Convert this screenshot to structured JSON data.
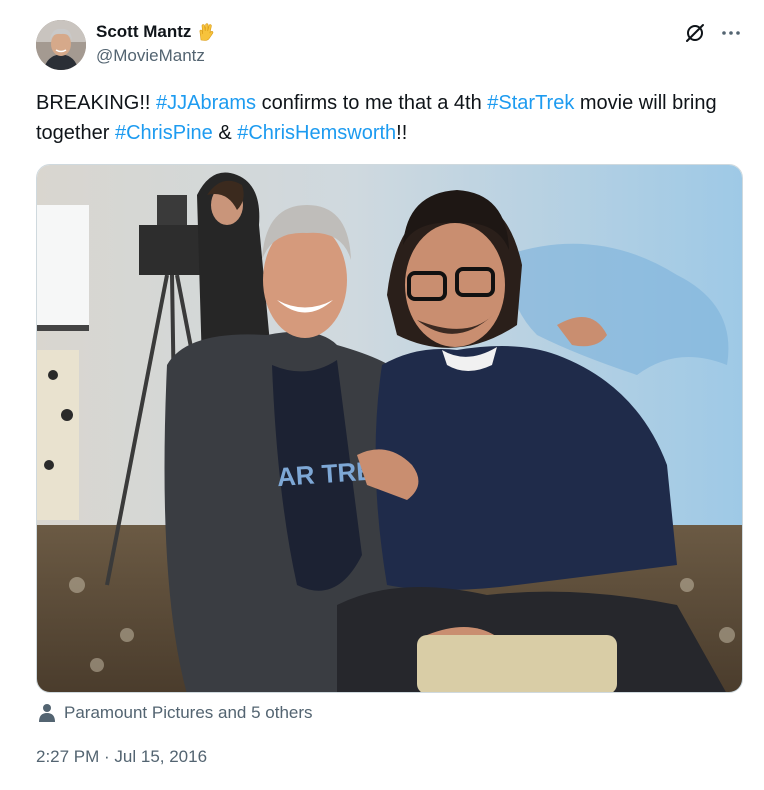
{
  "author": {
    "display_name": "Scott Mantz",
    "handle": "@MovieMantz",
    "badge_icon": "vulcan-salute-emoji"
  },
  "tweet": {
    "segments": [
      {
        "text": "BREAKING!! ",
        "type": "text"
      },
      {
        "text": "#JJAbrams",
        "type": "hashtag"
      },
      {
        "text": " confirms to me that a 4th ",
        "type": "text"
      },
      {
        "text": "#StarTrek",
        "type": "hashtag"
      },
      {
        "text": " movie will bring together ",
        "type": "text"
      },
      {
        "text": "#ChrisPine",
        "type": "hashtag"
      },
      {
        "text": " & ",
        "type": "text"
      },
      {
        "text": "#ChrisHemsworth",
        "type": "hashtag"
      },
      {
        "text": "!!",
        "type": "text"
      }
    ]
  },
  "media": {
    "shirt_text": "AR TRE"
  },
  "tagged": {
    "icon": "person-icon",
    "label": "Paramount Pictures and 5 others"
  },
  "meta": {
    "time": "2:27 PM",
    "separator": " · ",
    "date": "Jul 15, 2016"
  },
  "colors": {
    "hashtag": "#1d9bf0",
    "secondary_text": "#536471",
    "primary_text": "#0f1419"
  },
  "actions": {
    "grok_icon": "grok-icon",
    "more_icon": "more-icon"
  }
}
